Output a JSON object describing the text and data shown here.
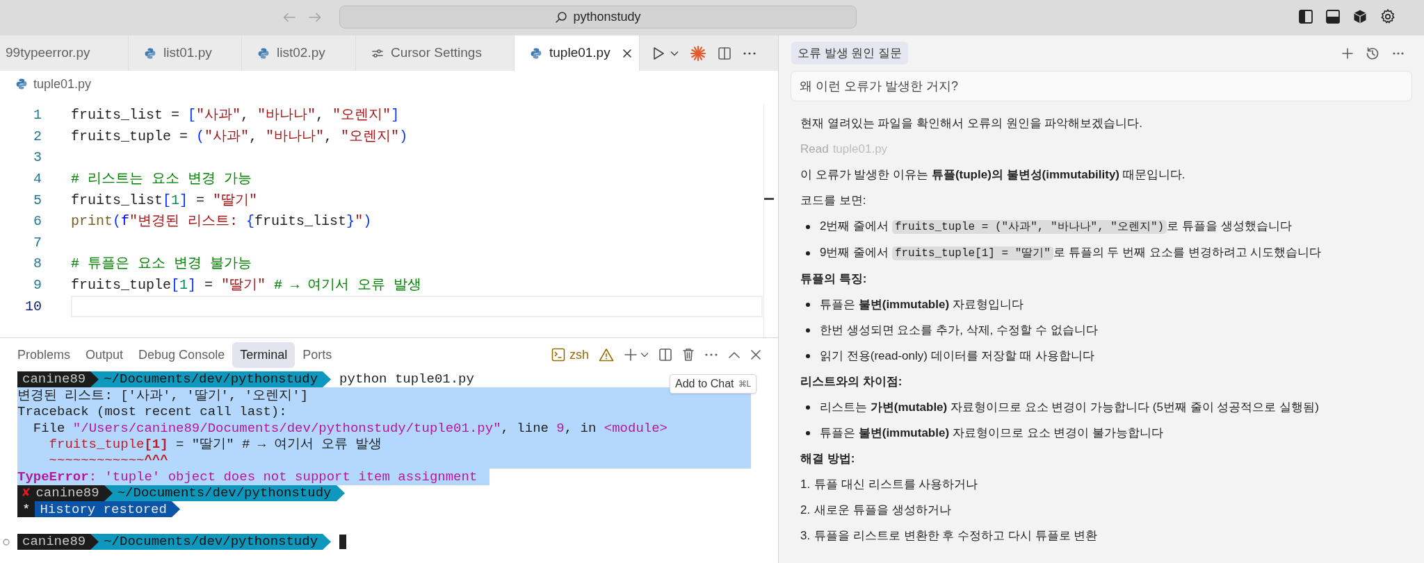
{
  "title_bar": {
    "search": "pythonstudy"
  },
  "tabs": [
    {
      "label": "99typeerror.py",
      "selected": false
    },
    {
      "label": "list01.py",
      "selected": false
    },
    {
      "label": "list02.py",
      "selected": false
    },
    {
      "label": "Cursor Settings",
      "selected": false
    },
    {
      "label": "tuple01.py",
      "selected": true
    }
  ],
  "breadcrumb": "tuple01.py",
  "editor": {
    "lines": [
      {
        "number": "1",
        "current": false,
        "tokens": [
          {
            "text": "fruits_list = ",
            "kind": "plain"
          },
          {
            "text": "[",
            "kind": "bracket"
          },
          {
            "text": "\"사과\"",
            "kind": "string"
          },
          {
            "text": ", ",
            "kind": "plain"
          },
          {
            "text": "\"바나나\"",
            "kind": "string"
          },
          {
            "text": ", ",
            "kind": "plain"
          },
          {
            "text": "\"오렌지\"",
            "kind": "string"
          },
          {
            "text": "]",
            "kind": "bracket"
          }
        ]
      },
      {
        "number": "2",
        "current": false,
        "tokens": [
          {
            "text": "fruits_tuple = ",
            "kind": "plain"
          },
          {
            "text": "(",
            "kind": "bracket"
          },
          {
            "text": "\"사과\"",
            "kind": "string"
          },
          {
            "text": ", ",
            "kind": "plain"
          },
          {
            "text": "\"바나나\"",
            "kind": "string"
          },
          {
            "text": ", ",
            "kind": "plain"
          },
          {
            "text": "\"오렌지\"",
            "kind": "string"
          },
          {
            "text": ")",
            "kind": "bracket"
          }
        ]
      },
      {
        "number": "3",
        "current": false
      },
      {
        "number": "4",
        "current": false,
        "tokens": [
          {
            "text": "# 리스트는 요소 변경 가능",
            "kind": "comment"
          }
        ]
      },
      {
        "number": "5",
        "current": false,
        "tokens": [
          {
            "text": "fruits_list",
            "kind": "plain"
          },
          {
            "text": "[",
            "kind": "bracket"
          },
          {
            "text": "1",
            "kind": "number"
          },
          {
            "text": "]",
            "kind": "bracket"
          },
          {
            "text": " = ",
            "kind": "plain"
          },
          {
            "text": "\"딸기\"",
            "kind": "string"
          }
        ]
      },
      {
        "number": "6",
        "current": false,
        "tokens": [
          {
            "text": "print",
            "kind": "function"
          },
          {
            "text": "(",
            "kind": "bracket"
          },
          {
            "text": "f",
            "kind": "keyword"
          },
          {
            "text": "\"변경된 리스트: ",
            "kind": "string"
          },
          {
            "text": "{",
            "kind": "bracket"
          },
          {
            "text": "fruits_list",
            "kind": "plain"
          },
          {
            "text": "}",
            "kind": "bracket"
          },
          {
            "text": "\"",
            "kind": "string"
          },
          {
            "text": ")",
            "kind": "bracket"
          }
        ]
      },
      {
        "number": "7",
        "current": false
      },
      {
        "number": "8",
        "current": false,
        "tokens": [
          {
            "text": "# 튜플은 요소 변경 불가능",
            "kind": "comment"
          }
        ]
      },
      {
        "number": "9",
        "current": false,
        "tokens": [
          {
            "text": "fruits_tuple",
            "kind": "plain"
          },
          {
            "text": "[",
            "kind": "bracket"
          },
          {
            "text": "1",
            "kind": "number"
          },
          {
            "text": "]",
            "kind": "bracket"
          },
          {
            "text": " = ",
            "kind": "plain"
          },
          {
            "text": "\"딸기\"",
            "kind": "string"
          },
          {
            "text": " # → 여기서 오류 발생",
            "kind": "comment"
          }
        ]
      },
      {
        "number": "10",
        "current": true
      }
    ]
  },
  "panel": {
    "tabs": [
      {
        "label": "Problems",
        "selected": false
      },
      {
        "label": "Output",
        "selected": false
      },
      {
        "label": "Debug Console",
        "selected": false
      },
      {
        "label": "Terminal",
        "selected": true
      },
      {
        "label": "Ports",
        "selected": false
      }
    ],
    "shell": "zsh",
    "tooltip": {
      "label": "Add to Chat",
      "shortcut": "⌘L"
    }
  },
  "terminal": {
    "lines": [
      {
        "kind": "prompt",
        "marker": false,
        "segments": [
          {
            "kind": "user",
            "text": "canine89",
            "error_mark": false
          },
          {
            "kind": "path",
            "text": "~/Documents/dev/pythonstudy"
          }
        ],
        "command": "python tuple01.py",
        "cursor": false
      },
      {
        "kind": "output",
        "selected": true,
        "tokens": [
          {
            "text": "변경된 리스트: ['사과', '딸기', '오렌지']",
            "kind": "plain"
          }
        ]
      },
      {
        "kind": "output",
        "selected": true,
        "tokens": [
          {
            "text": "Traceback (most recent call last):",
            "kind": "plain"
          }
        ]
      },
      {
        "kind": "output",
        "selected": true,
        "tokens": [
          {
            "text": "  File ",
            "kind": "plain"
          },
          {
            "text": "\"/Users/canine89/Documents/dev/pythonstudy/tuple01.py\"",
            "kind": "purple"
          },
          {
            "text": ", line ",
            "kind": "plain"
          },
          {
            "text": "9",
            "kind": "purple"
          },
          {
            "text": ", in ",
            "kind": "plain"
          },
          {
            "text": "<module>",
            "kind": "purple"
          }
        ]
      },
      {
        "kind": "output",
        "selected": true,
        "tokens": [
          {
            "text": "    fruits_tuple",
            "kind": "red"
          },
          {
            "text": "[1]",
            "kind": "red-bold"
          },
          {
            "text": " = \"딸기\" # → 여기서 오류 발생",
            "kind": "plain"
          }
        ]
      },
      {
        "kind": "output",
        "selected": true,
        "tokens": [
          {
            "text": "    ~~~~~~~~~~~~",
            "kind": "red"
          },
          {
            "text": "^^^",
            "kind": "red-bold"
          }
        ]
      },
      {
        "kind": "output",
        "selected": true,
        "tokens": [
          {
            "text": "TypeError",
            "kind": "purple-bold"
          },
          {
            "text": ": 'tuple' object does not support item assignment",
            "kind": "purple"
          }
        ]
      },
      {
        "kind": "prompt",
        "marker": false,
        "segments": [
          {
            "kind": "user",
            "text": "canine89",
            "error_mark": "✘"
          },
          {
            "kind": "path",
            "text": "~/Documents/dev/pythonstudy"
          }
        ],
        "cursor": false
      },
      {
        "kind": "prompt",
        "marker": false,
        "segments": [
          {
            "kind": "star",
            "text": "*"
          },
          {
            "kind": "info",
            "text": "History restored"
          }
        ],
        "cursor": false
      },
      {
        "kind": "blank"
      },
      {
        "kind": "prompt",
        "marker": true,
        "segments": [
          {
            "kind": "user",
            "text": "canine89",
            "error_mark": false
          },
          {
            "kind": "path",
            "text": "~/Documents/dev/pythonstudy"
          }
        ],
        "cursor": true
      }
    ]
  },
  "chat": {
    "title": "오류 발생 원인 질문",
    "question": "왜 이런 오류가 발생한 거지?",
    "blocks": [
      {
        "kind": "paragraph",
        "text": "현재 열려있는 파일을 확인해서 오류의 원인을 파악해보겠습니다."
      },
      {
        "kind": "read",
        "label": "Read",
        "file": "tuple01.py"
      },
      {
        "kind": "paragraph",
        "text": "이 오류가 발생한 이유는 **튜플(tuple)의 불변성(immutability)** 때문입니다."
      },
      {
        "kind": "paragraph",
        "text": "코드를 보면:"
      },
      {
        "kind": "bullet",
        "segments": [
          {
            "text": "2번째 줄에서 ",
            "code": false
          },
          {
            "text": "fruits_tuple = (\"사과\", \"바나나\", \"오렌지\")",
            "code": true
          },
          {
            "text": "로 튜플을 생성했습니다",
            "code": false
          }
        ]
      },
      {
        "kind": "bullet",
        "segments": [
          {
            "text": "9번째 줄에서 ",
            "code": false
          },
          {
            "text": "fruits_tuple[1] = \"딸기\"",
            "code": true
          },
          {
            "text": "로 튜플의 두 번째 요소를 변경하려고 시도했습니다",
            "code": false
          }
        ]
      },
      {
        "kind": "heading",
        "text": "튜플의 특징:"
      },
      {
        "kind": "bullet",
        "segments": [
          {
            "text": "튜플은 **불변(immutable)** 자료형입니다",
            "code": false
          }
        ]
      },
      {
        "kind": "bullet",
        "segments": [
          {
            "text": "한번 생성되면 요소를 추가, 삭제, 수정할 수 없습니다",
            "code": false
          }
        ]
      },
      {
        "kind": "bullet",
        "segments": [
          {
            "text": "읽기 전용(read-only) 데이터를 저장할 때 사용합니다",
            "code": false
          }
        ]
      },
      {
        "kind": "heading",
        "text": "리스트와의 차이점:"
      },
      {
        "kind": "bullet",
        "segments": [
          {
            "text": "리스트는 **가변(mutable)** 자료형이므로 요소 변경이 가능합니다 (5번째 줄이 성공적으로 실행됨)",
            "code": false
          }
        ]
      },
      {
        "kind": "bullet",
        "segments": [
          {
            "text": "튜플은 **불변(immutable)** 자료형이므로 요소 변경이 불가능합니다",
            "code": false
          }
        ]
      },
      {
        "kind": "heading",
        "text": "해결 방법:"
      },
      {
        "kind": "numbered",
        "number": "1.",
        "text": "튜플 대신 리스트를 사용하거나"
      },
      {
        "kind": "numbered",
        "number": "2.",
        "text": "새로운 튜플을 생성하거나"
      },
      {
        "kind": "numbered",
        "number": "3.",
        "text": "튜플을 리스트로 변환한 후 수정하고 다시 튜플로 변환"
      }
    ]
  }
}
